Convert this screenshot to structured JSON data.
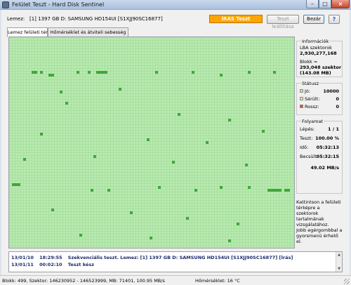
{
  "window": {
    "title": "Felület Teszt - Hard Disk Sentinel",
    "minimize_label": "–",
    "maximize_label": "□",
    "close_label": "×"
  },
  "disk": {
    "label": "Lemez:",
    "name": "[1] 1397 GB D: SAMSUNG HD154UI [S1XJJ90SC16877]"
  },
  "toolbar": {
    "status": "ÍRÁS Teszt",
    "status_color": "#ffa500",
    "stop_label": "Teszt leállítása",
    "close_label": "Bezár",
    "help_label": "?"
  },
  "tabs": [
    {
      "label": "Lemez felületi térkép",
      "active": true
    },
    {
      "label": "Hőmérséklet és átviteli sebesség",
      "active": false
    }
  ],
  "surface_map": {
    "block_color": "#b8eab0",
    "highlight_color": "#3ea83a",
    "grid_color": "#9bd692"
  },
  "info": {
    "title": "Információk",
    "lba_label": "LBA szektorok",
    "lba_value": "2,930,277,168",
    "block_label": "Blokk =",
    "block_value": "293,048 szektor",
    "block_size": "(143.08 MB)"
  },
  "status": {
    "title": "Státusz",
    "good_label": "Jó:",
    "good_value": "10000",
    "damaged_label": "Sérült:",
    "damaged_value": "0",
    "bad_label": "Rossz:",
    "bad_value": "0",
    "good_color": "#b8eab0",
    "damaged_color": "#f0e090",
    "bad_color": "#e05040"
  },
  "progress": {
    "title": "Folyamat",
    "step_label": "Lépés:",
    "step_value": "1 / 1",
    "test_label": "Teszt:",
    "test_value": "100.00 %",
    "time_label": "Idő:",
    "time_value": "05:32:13",
    "est_label": "Becsült:",
    "est_value": "05:32:15",
    "speed_value": "49.02 MB/s"
  },
  "hints": {
    "line1": "Kattintson a felületi térképre a szektorok tartalmának vizsgálatához.",
    "line2": "Jobb egérgombbal a gyorsmenü érhető el."
  },
  "log": [
    {
      "date": "13/01/10",
      "time": "18:29:55",
      "text": "Szekvenciális teszt. Lemez: [1] 1397 GB D: SAMSUNG HD154UI [S1XJJ90SC16877] [Írás]"
    },
    {
      "date": "13/01/11",
      "time": "00:02:10",
      "text": "Teszt kész"
    }
  ],
  "statusbar": {
    "left": "Blokk: 499, Szektor: 146230952 - 146523999, MB: 71401, 100.95 MB/s",
    "temp": "Hőmérséklet: 16 °C"
  }
}
